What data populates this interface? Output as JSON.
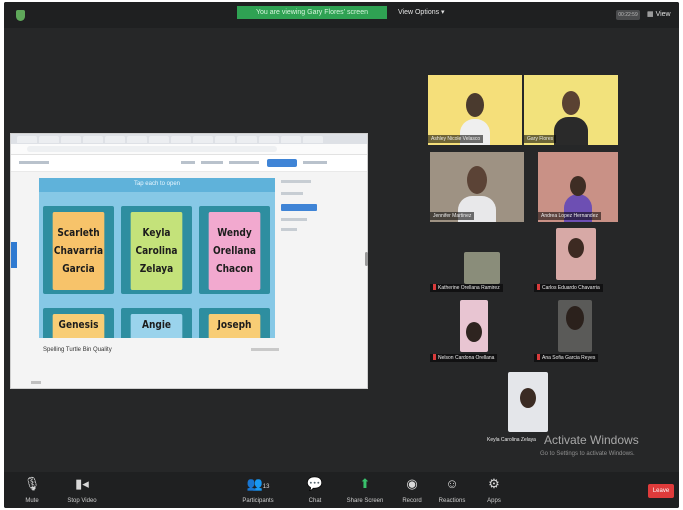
{
  "topbar": {
    "share_banner": "You are viewing Gary Flores' screen",
    "view_options": "View Options ▾",
    "right_box": "00:22:59",
    "view_label": "View"
  },
  "shared_screen": {
    "board_title": "Tap each to open",
    "cards": [
      {
        "lines": [
          "Scarleth",
          "Chavarria",
          "Garcia"
        ],
        "color": "orange"
      },
      {
        "lines": [
          "Keyla",
          "Carolina",
          "Zelaya"
        ],
        "color": "green"
      },
      {
        "lines": [
          "Wendy",
          "Orellana",
          "Chacon"
        ],
        "color": "pink"
      },
      {
        "lines": [
          "Genesis"
        ],
        "color": "yellow"
      },
      {
        "lines": [
          "Angie"
        ],
        "color": "blue"
      },
      {
        "lines": [
          "Joseph"
        ],
        "color": "yellow"
      }
    ],
    "caption": "Spelling Turtle Bin Quality"
  },
  "participants": [
    {
      "name": "Ashley Nicole Velasco"
    },
    {
      "name": "Gary Flores"
    },
    {
      "name": "Jennifer Martinez"
    },
    {
      "name": "Andrea Lopez Hernandez"
    },
    {
      "name": "Katherine Orellana Ramirez"
    },
    {
      "name": "Carlos Eduardo Chavarria"
    },
    {
      "name": "Nelson Cardona Orellana"
    },
    {
      "name": "Ana Sofia Garcia Reyes"
    },
    {
      "name": "Keyla Carolina Zelaya"
    }
  ],
  "watermark": {
    "title": "Activate Windows",
    "subtitle": "Go to Settings to activate Windows."
  },
  "toolbar": {
    "mute": "Mute",
    "stop_video": "Stop Video",
    "participants": "Participants",
    "participants_count": "13",
    "chat": "Chat",
    "share_screen": "Share Screen",
    "record": "Record",
    "reactions": "Reactions",
    "apps": "Apps",
    "leave": "Leave"
  },
  "colors": {
    "accent_green": "#2fa253",
    "leave_red": "#df3b3b",
    "window_dark": "#262728"
  }
}
